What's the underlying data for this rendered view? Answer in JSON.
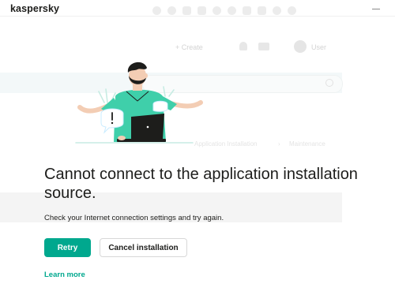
{
  "window": {
    "brand": "kaspersky"
  },
  "background": {
    "create_label": "+ Create",
    "user_label": "User",
    "crumb_1": "Application Installation",
    "crumb_2": "Maintenance"
  },
  "message": {
    "title": "Cannot connect to the application installation source.",
    "body": "Check your Internet connection settings and try again."
  },
  "actions": {
    "retry_label": "Retry",
    "cancel_label": "Cancel installation",
    "learn_more_label": "Learn more"
  },
  "colors": {
    "accent": "#00a88e",
    "illustration_shirt": "#3fcfaa",
    "illustration_hair": "#1d1d1b",
    "illustration_skin": "#f3cdb4"
  },
  "icons": [
    "minimize-icon",
    "person-laptop-illustration",
    "alert-bubble-icon"
  ]
}
